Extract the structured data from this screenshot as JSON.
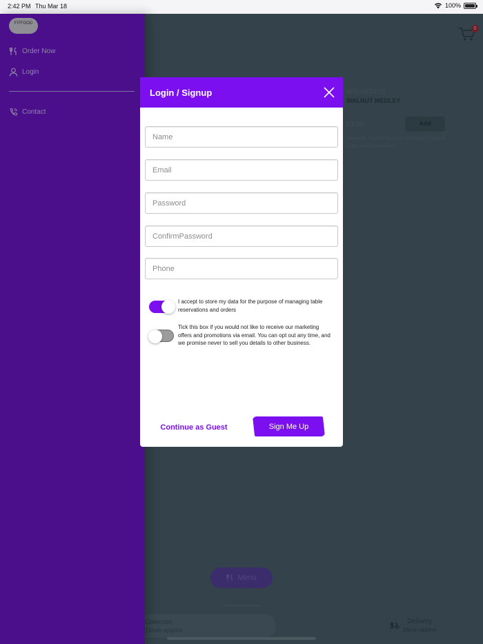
{
  "status_bar": {
    "time": "2:42 PM",
    "date": "Thu Mar 18",
    "battery": "100%"
  },
  "background": {
    "cart_count": "0",
    "product": {
      "category": "BREAKFAST",
      "name": "WALNUT MEDLEY",
      "price": "£3.00",
      "add_label": "Add",
      "description": "Walnuts, Fresh Berries, Cottage Cheese, Oats and Flaxseeds"
    },
    "menu_label": "Menu",
    "collection_label": "Collection",
    "collection_sub": "15min approx",
    "delivery_label": "Delivery",
    "delivery_sub": "25min approx"
  },
  "drawer": {
    "logo_text": "FITFOOD",
    "items": [
      {
        "label": "Order Now",
        "icon": "cutlery-icon"
      },
      {
        "label": "Login",
        "icon": "user-icon"
      },
      {
        "label": "Contact",
        "icon": "phone-icon"
      }
    ]
  },
  "modal": {
    "title": "Login / Signup",
    "fields": {
      "name": "Name",
      "email": "Email",
      "password": "Password",
      "confirm_password": "ConfirmPassword",
      "phone": "Phone"
    },
    "consent_data": {
      "text": "I accept to store my data for the purpose of managing table reservations and orders",
      "checked": true
    },
    "consent_marketing": {
      "text": "Tick this box if you would not like to receive our marketing offers and promotions via email. You can opt out any time, and we promise never to sell you details to other business.",
      "checked": false
    },
    "guest_label": "Continue as Guest",
    "signup_label": "Sign Me Up"
  },
  "colors": {
    "accent": "#7b0ff0",
    "drawer": "#4b0f8c",
    "overlay": "#34434b"
  }
}
